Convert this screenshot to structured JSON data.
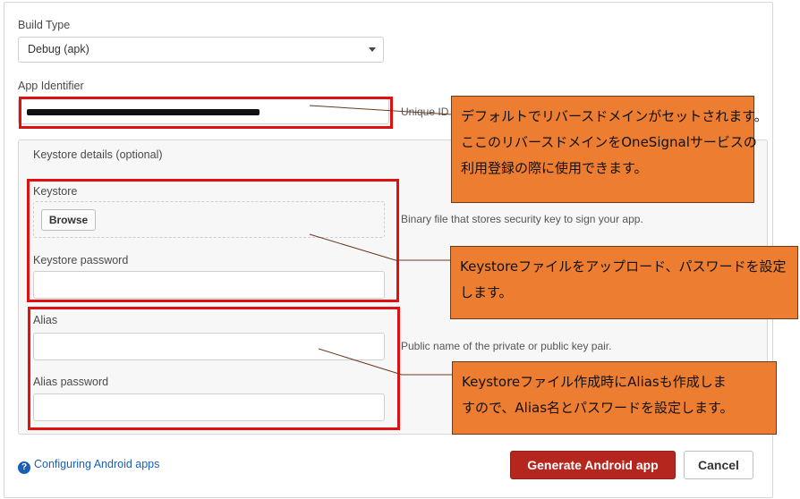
{
  "form": {
    "build_type_label": "Build Type",
    "build_type_value": "Debug (apk)",
    "app_identifier_label": "App Identifier",
    "app_identifier_hint": "Unique ID",
    "keystore_details_label": "Keystore details (optional)",
    "keystore_label": "Keystore",
    "browse_label": "Browse",
    "keystore_hint": "Binary file that stores security key to sign your app.",
    "keystore_password_label": "Keystore password",
    "keystore_password_value": "",
    "alias_label": "Alias",
    "alias_value": "",
    "alias_hint": "Public name of the private or public key pair.",
    "alias_password_label": "Alias password",
    "alias_password_value": ""
  },
  "footer": {
    "help_link": "Configuring Android apps",
    "generate_label": "Generate Android app",
    "cancel_label": "Cancel"
  },
  "callouts": {
    "app_identifier": [
      "デフォルトでリバースドメインがセットされます。",
      "ここのリバースドメインをOneSignalサービスの",
      "利用登録の際に使用できます。"
    ],
    "keystore": [
      "Keystoreファイルをアップロード、パスワードを設定",
      "します。"
    ],
    "alias": [
      "Keystoreファイル作成時にAliasも作成しま",
      "すので、Alias名とパスワードを設定します。"
    ]
  },
  "colors": {
    "accent_red": "#b5271e",
    "highlight_red": "#e01010",
    "callout_orange": "#ed7d31",
    "link_blue": "#1a5fb4"
  },
  "icons": {
    "help": "question-circle-icon",
    "select": "chevron-down-icon"
  }
}
